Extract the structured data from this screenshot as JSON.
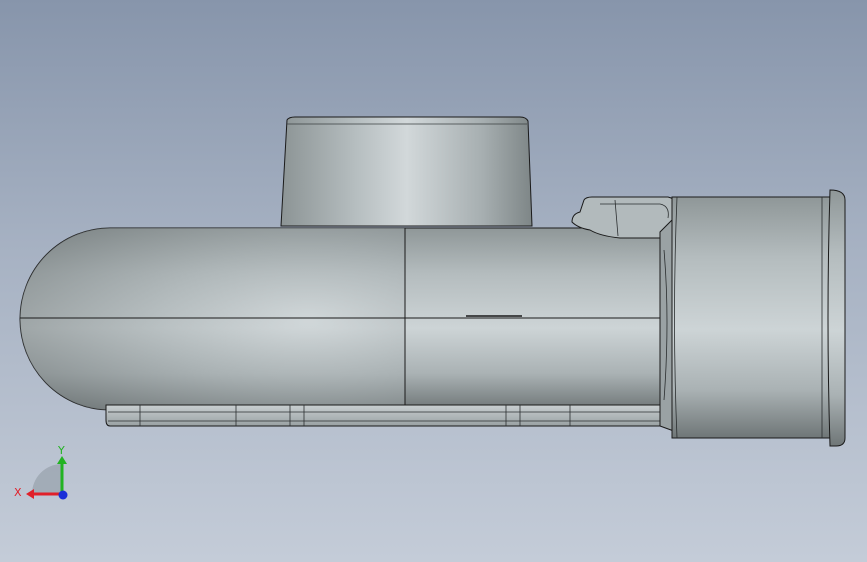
{
  "viewport": {
    "background_top": "#8795ab",
    "background_bottom": "#c4ccd8"
  },
  "model": {
    "body_color": "#b8c0c2",
    "edge_color": "#1a1a1a"
  },
  "triad": {
    "x_label": "X",
    "y_label": "Y",
    "x_color": "#e0202a",
    "y_color": "#22b322",
    "z_color": "#1a2fd8"
  }
}
